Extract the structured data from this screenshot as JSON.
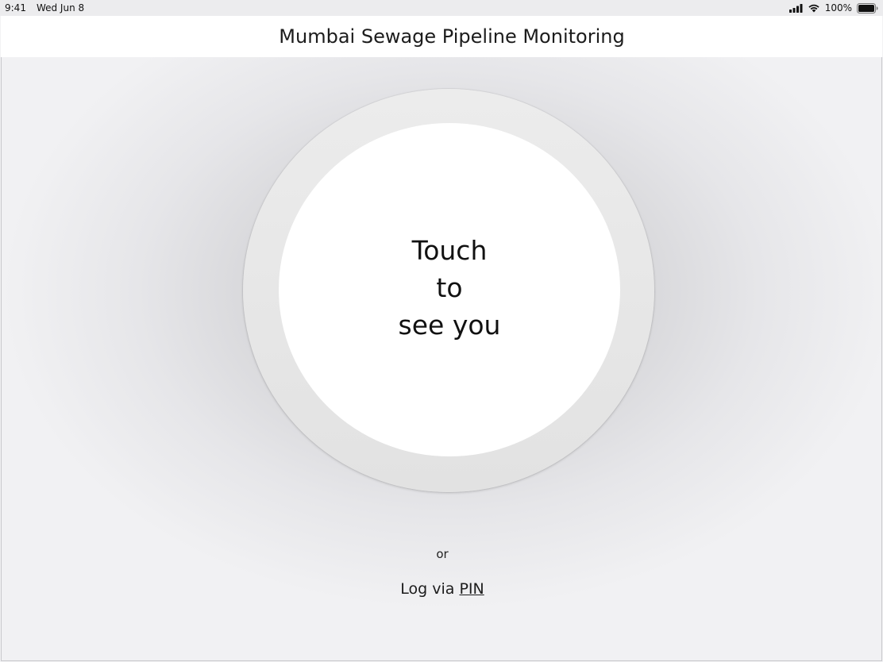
{
  "status_bar": {
    "time": "9:41",
    "date": "Wed Jun 8",
    "battery_percent": "100%",
    "icons": [
      "cellular-signal-icon",
      "wifi-icon",
      "battery-icon"
    ]
  },
  "header": {
    "title": "Mumbai Sewage Pipeline Monitoring"
  },
  "touch": {
    "line1": "Touch",
    "line2": "to",
    "line3": "see you"
  },
  "alt": {
    "or_label": "or",
    "log_prefix": "Log via",
    "pin_link": "PIN"
  },
  "colors": {
    "header_bg": "#ffffff",
    "background": "#f2f2f4",
    "ring": "#e6e6e6",
    "button": "#ffffff",
    "text": "#1c1c1c"
  }
}
